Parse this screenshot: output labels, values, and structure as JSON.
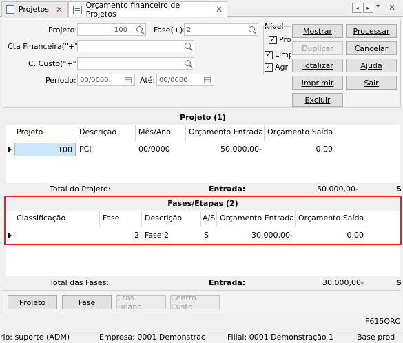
{
  "tabs": [
    {
      "label": "Projetos"
    },
    {
      "label": "Orçamento financeiro de Projetos"
    }
  ],
  "tab_nav": {
    "prev": "◂",
    "next": "▸",
    "menu": "▾",
    "close": "✕"
  },
  "filters": {
    "projeto_label": "Projeto:",
    "projeto_value": "100",
    "fase_label": "Fase(+):",
    "fase_value": "2",
    "cta_label": "Cta Financeira(\"+\"):",
    "cta_value": "",
    "custo_label": "C. Custo(\"+\"):",
    "custo_value": "",
    "periodo_label": "Período:",
    "periodo_value": "00/0000",
    "ate_label": "Até:",
    "ate_value": "00/0000"
  },
  "options": {
    "nivel_label": "Nível",
    "pro_label": "Pro",
    "limp_label": "Limp",
    "agr_label": "Agr"
  },
  "buttons": {
    "mostrar": "Mostrar",
    "processar": "Processar",
    "duplicar": "Duplicar",
    "cancelar": "Cancelar",
    "totalizar": "Totalizar",
    "ajuda": "Ajuda",
    "imprimir": "Imprimir",
    "sair": "Sair",
    "excluir": "Excluir"
  },
  "projeto_grid": {
    "title": "Projeto (1)",
    "columns": [
      "Projeto",
      "Descrição",
      "Mês/Ano",
      "Orçamento Entrada",
      "Orçamento Saída"
    ],
    "rows": [
      {
        "projeto": "100",
        "descricao": "PCI",
        "mes_ano": "00/0000",
        "entrada": "50.000,00-",
        "saida": "0,00"
      }
    ],
    "total_label": "Total do Projeto:",
    "entrada_label": "Entrada:",
    "entrada_value": "50.000,00-",
    "trailing": "S"
  },
  "fases_grid": {
    "title": "Fases/Etapas (2)",
    "columns": [
      "Classificação",
      "Fase",
      "Descrição",
      "A/S",
      "Orçamento Entrada",
      "Orçamento Saída"
    ],
    "rows": [
      {
        "classificacao": "",
        "fase": "2",
        "descricao": "Fase 2",
        "as": "S",
        "entrada": "30.000,00-",
        "saida": "0,00"
      }
    ],
    "total_label": "Total das Fases:",
    "entrada_label": "Entrada:",
    "entrada_value": "30.000,00-",
    "trailing": "S"
  },
  "bottom_buttons": {
    "projeto": "Projeto",
    "fase": "Fase",
    "ctas_financ": "Ctas. Financ.",
    "centro_custo": "Centro Custo"
  },
  "screen_code": "F615ORC",
  "statusbar": {
    "usuario": "rio: suporte (ADM)",
    "empresa": "Empresa: 0001 Demonstrac",
    "filial": "Filial: 0001 Demonstração 1",
    "base": "Base prod"
  },
  "colors": {
    "highlight_border": "#e0202a",
    "selection": "#cce6ff"
  }
}
